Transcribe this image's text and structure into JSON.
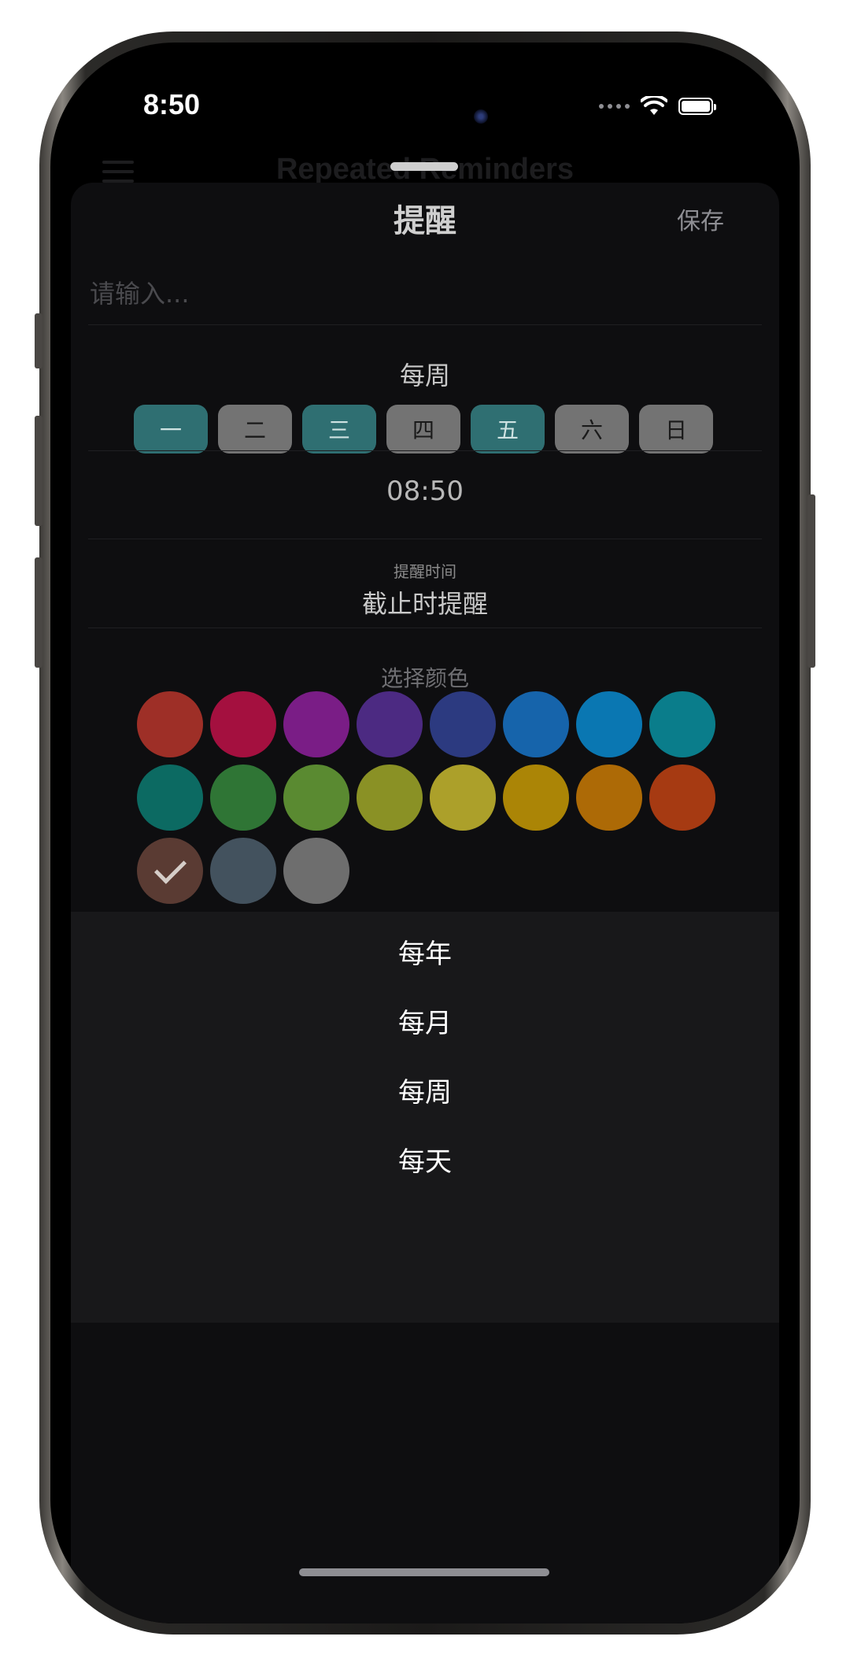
{
  "status_bar": {
    "time": "8:50"
  },
  "background": {
    "title": "Repeated Reminders"
  },
  "sheet": {
    "title": "提醒",
    "save_label": "保存",
    "input_placeholder": "请输入...",
    "repeat_label": "每周",
    "weekdays": [
      {
        "label": "一",
        "selected": true
      },
      {
        "label": "二",
        "selected": false
      },
      {
        "label": "三",
        "selected": true
      },
      {
        "label": "四",
        "selected": false
      },
      {
        "label": "五",
        "selected": true
      },
      {
        "label": "六",
        "selected": false
      },
      {
        "label": "日",
        "selected": false
      }
    ],
    "time": "08:50",
    "remind_caption": "提醒时间",
    "remind_value": "截止时提醒",
    "color_caption": "选择颜色",
    "colors": [
      "#9e2f27",
      "#a4103f",
      "#7a1d86",
      "#4c2a82",
      "#2c3a80",
      "#1664ab",
      "#0a77b2",
      "#0a7d8b",
      "#0c6a62",
      "#2f7535",
      "#5a8a31",
      "#8a9125",
      "#aca02a",
      "#ab8506",
      "#ad6a06",
      "#a63a12",
      "#5a3b33",
      "#43525e",
      "#6e6e6e"
    ],
    "selected_color_index": 16
  },
  "picker": {
    "options": [
      "每年",
      "每月",
      "每周",
      "每天"
    ]
  }
}
